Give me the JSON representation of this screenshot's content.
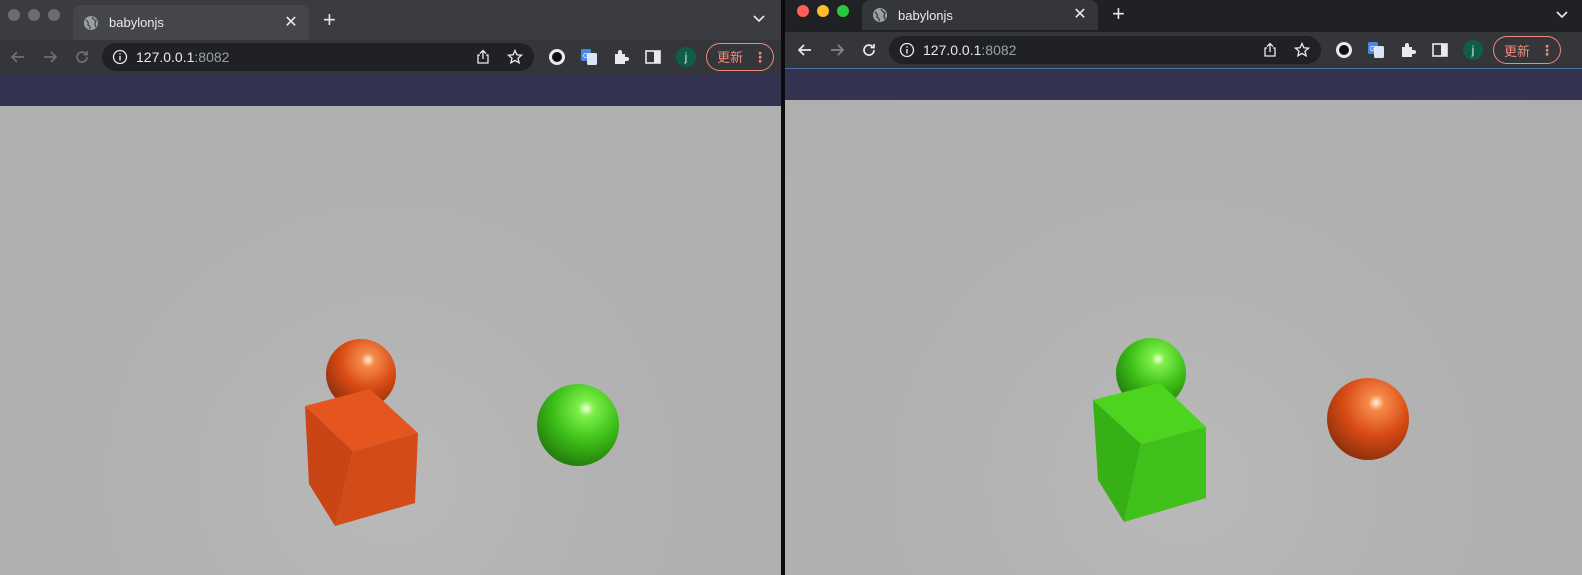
{
  "windows": [
    {
      "tab": {
        "title": "babylonjs",
        "favicon": "globe-icon"
      },
      "address": {
        "host": "127.0.0.1",
        "port": ":8082"
      },
      "update_button": {
        "label": "更新"
      },
      "avatar_initial": "j",
      "scene": {
        "back_sphere": "orange",
        "cube": "orange",
        "right_sphere": "green"
      }
    },
    {
      "tab": {
        "title": "babylonjs",
        "favicon": "globe-icon"
      },
      "address": {
        "host": "127.0.0.1",
        "port": ":8082"
      },
      "update_button": {
        "label": "更新"
      },
      "avatar_initial": "j",
      "scene": {
        "back_sphere": "green",
        "cube": "green",
        "right_sphere": "orange"
      }
    }
  ],
  "colors": {
    "orange": "#e0501a",
    "green": "#3fc21a",
    "canvas_bg": "#b1b1b1",
    "banner": "#343451",
    "update_accent": "#ee8a7e"
  }
}
